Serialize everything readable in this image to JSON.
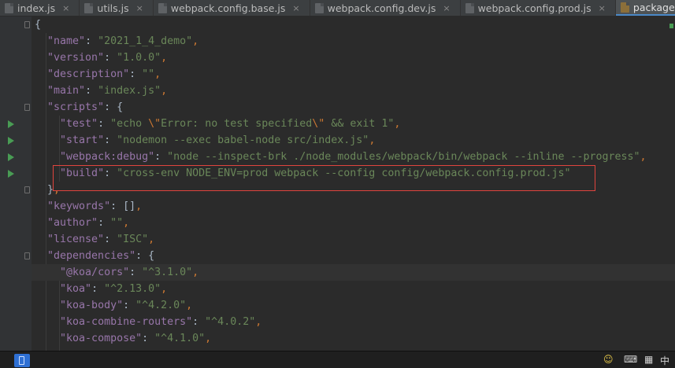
{
  "tabs": [
    {
      "label": "index.js",
      "active": false
    },
    {
      "label": "utils.js",
      "active": false
    },
    {
      "label": "webpack.config.base.js",
      "active": false
    },
    {
      "label": "webpack.config.dev.js",
      "active": false
    },
    {
      "label": "webpack.config.prod.js",
      "active": false
    },
    {
      "label": "package.json",
      "active": true
    }
  ],
  "close_glyph": "×",
  "code": {
    "open_brace": "{",
    "name_key": "\"name\"",
    "name_val": "\"2021_1_4_demo\"",
    "version_key": "\"version\"",
    "version_val": "\"1.0.0\"",
    "description_key": "\"description\"",
    "description_val": "\"\"",
    "main_key": "\"main\"",
    "main_val": "\"index.js\"",
    "scripts_key": "\"scripts\"",
    "scripts_open": "{",
    "test_key": "\"test\"",
    "test_val_a": "\"echo ",
    "test_val_esc1": "\\\"",
    "test_val_b": "Error: no test specified",
    "test_val_esc2": "\\\"",
    "test_val_c": " && exit 1\"",
    "start_key": "\"start\"",
    "start_val": "\"nodemon --exec babel-node src/index.js\"",
    "debug_key": "\"webpack:debug\"",
    "debug_val": "\"node --inspect-brk ./node_modules/webpack/bin/webpack --inline --progress\"",
    "build_key": "\"build\"",
    "build_val": "\"cross-env NODE_ENV=prod webpack --config config/webpack.config.prod.js\"",
    "scripts_close": "}",
    "keywords_key": "\"keywords\"",
    "keywords_val": "[]",
    "author_key": "\"author\"",
    "author_val": "\"\"",
    "license_key": "\"license\"",
    "license_val": "\"ISC\"",
    "deps_key": "\"dependencies\"",
    "deps_open": "{",
    "cors_key": "\"@koa/cors\"",
    "cors_val": "\"^3.1.0\"",
    "koa_key": "\"koa\"",
    "koa_val": "\"^2.13.0\"",
    "body_key": "\"koa-body\"",
    "body_val": "\"^4.2.0\"",
    "routers_key": "\"koa-combine-routers\"",
    "routers_val": "\"^4.0.2\"",
    "compose_key": "\"koa-compose\"",
    "compose_val": "\"^4.1.0\"",
    "colon": ": ",
    "comma": ","
  },
  "taskbar": {
    "ime_label": "中",
    "tray_icons": [
      "smiley-plus-icon",
      "keyboard-icon",
      "grid-icon"
    ]
  },
  "colors": {
    "key": "#9876aa",
    "string": "#6a8759",
    "punct": "#cc7832",
    "annotation": "#e0443e",
    "run_gutter": "#499c54"
  }
}
